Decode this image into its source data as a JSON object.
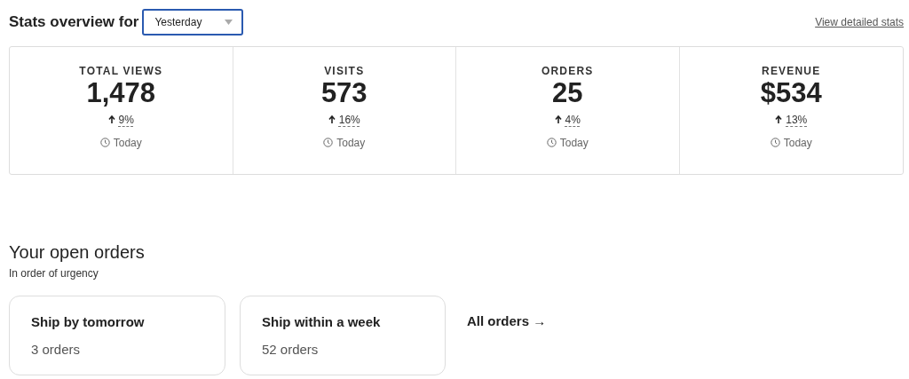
{
  "header": {
    "title": "Stats overview for",
    "period_select": {
      "value": "Yesterday"
    },
    "link": "View detailed stats"
  },
  "stats": [
    {
      "label": "TOTAL VIEWS",
      "value": "1,478",
      "change": "9%",
      "rising": true,
      "note": "Today"
    },
    {
      "label": "VISITS",
      "value": "573",
      "change": "16%",
      "rising": true,
      "note": "Today"
    },
    {
      "label": "ORDERS",
      "value": "25",
      "change": "4%",
      "rising": true,
      "note": "Today"
    },
    {
      "label": "REVENUE",
      "value": "$534",
      "change": "13%",
      "rising": true,
      "note": "Today"
    }
  ],
  "open_orders": {
    "title": "Your open orders",
    "subtitle": "In order of urgency",
    "cards": [
      {
        "title": "Ship by tomorrow",
        "count": "3 orders"
      },
      {
        "title": "Ship within a week",
        "count": "52 orders"
      }
    ],
    "link": "All orders →"
  }
}
